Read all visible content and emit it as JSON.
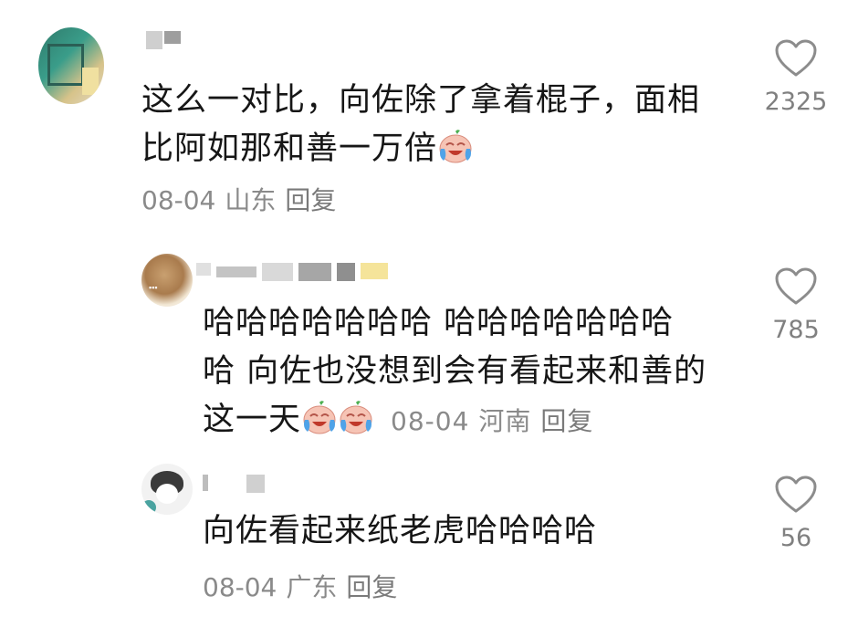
{
  "comments": [
    {
      "text_line1": "这么一对比，向佐除了拿着棍子，面相",
      "text_line2": "比阿如那和善一万倍",
      "emoji": "crying-laughing-emoji",
      "date": "08-04",
      "location": "山东",
      "reply_label": "回复",
      "likes": "2325"
    },
    {
      "text_line1": "哈哈哈哈哈哈哈 哈哈哈哈哈哈哈",
      "text_line2": "哈 向佐也没想到会有看起来和善的",
      "text_line3": "这一天",
      "emoji": "crying-laughing-emoji",
      "date": "08-04",
      "location": "河南",
      "reply_label": "回复",
      "likes": "785"
    },
    {
      "text_line1": "向佐看起来纸老虎哈哈哈哈",
      "date": "08-04",
      "location": "广东",
      "reply_label": "回复",
      "likes": "56"
    }
  ],
  "icons": {
    "like": "heart-outline-icon"
  },
  "colors": {
    "text": "#161616",
    "meta": "#8a8a8a",
    "heart": "#8c8c8c"
  }
}
